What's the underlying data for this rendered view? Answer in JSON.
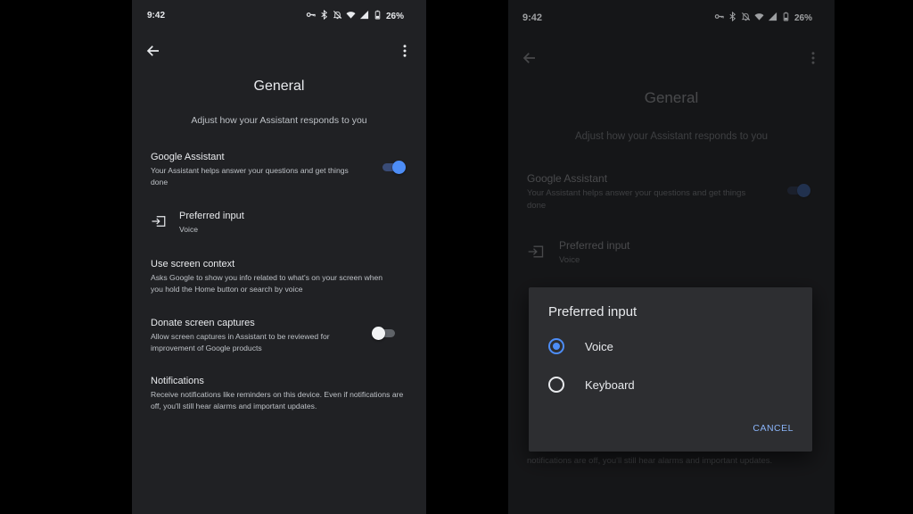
{
  "colors": {
    "background": "#000000",
    "surface": "#202124",
    "dialog_surface": "#2d2e31",
    "accent": "#4d8df6",
    "accent_text": "#8ab4f8"
  },
  "left_screen": {
    "status_bar": {
      "time": "9:42",
      "battery": "26%",
      "icons": [
        "key-icon",
        "bluetooth-icon",
        "notifications-off-icon",
        "wifi-icon",
        "signal-icon",
        "battery-icon"
      ]
    },
    "app_bar": {
      "back_icon": "arrow-back-icon",
      "menu_icon": "more-vert-icon"
    },
    "title": "General",
    "subtitle": "Adjust how your Assistant responds to you",
    "settings": [
      {
        "title": "Google Assistant",
        "description": "Your Assistant helps answer your questions and get things done",
        "toggle": "on"
      },
      {
        "title": "Preferred input",
        "description": "Voice",
        "icon": "input-icon"
      },
      {
        "title": "Use screen context",
        "description": "Asks Google to show you info related to what's on your screen when you hold the Home button or search by voice"
      },
      {
        "title": "Donate screen captures",
        "description": "Allow screen captures in Assistant to be reviewed for improvement of Google products",
        "toggle": "off"
      },
      {
        "title": "Notifications",
        "description": "Receive notifications like reminders on this device. Even if notifications are off, you'll still hear alarms and important updates."
      }
    ]
  },
  "right_screen": {
    "status_bar": {
      "time": "9:42",
      "battery": "26%"
    },
    "title": "General",
    "subtitle": "Adjust how your Assistant responds to you",
    "settings_visible": [
      {
        "title": "Google Assistant",
        "description": "Your Assistant helps answer your questions and get things done",
        "toggle": "on"
      },
      {
        "title": "Preferred input",
        "description": "Voice"
      }
    ],
    "bottom_text": "notifications are off, you'll still hear alarms and important updates.",
    "dialog": {
      "title": "Preferred input",
      "options": [
        {
          "label": "Voice",
          "selected": true
        },
        {
          "label": "Keyboard",
          "selected": false
        }
      ],
      "cancel_label": "CANCEL"
    }
  }
}
